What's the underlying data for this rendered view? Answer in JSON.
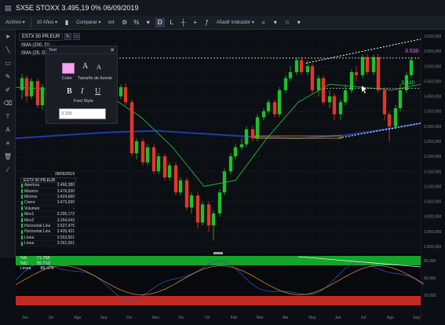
{
  "window": {
    "title": "SX5E STOXX 3.495,19 0% 06/09/2019"
  },
  "toolbar": {
    "archivo": "Archivo ▾",
    "period": "10 Años ▾",
    "compare": "Comparar ▾",
    "vol": "vol.",
    "add_indicator": "Añadir indicador ▾",
    "icons": [
      "menu-icon",
      "bar-style-icon",
      "percent-icon",
      "d-icon",
      "l-icon",
      "crosshair-icon",
      "plus-icon",
      "zoom-icon",
      "settings-icon",
      "star-icon"
    ]
  },
  "legend": {
    "symbol": "ESTX 50 PR.EUR",
    "sma200": "SMA (200, D)",
    "sma25": "SMA (25, D)"
  },
  "text_panel": {
    "title": "Text",
    "color_label": "Color",
    "size_label": "Tamaño de fuente",
    "font_style_label": "Font Style",
    "input_value": "3.330",
    "bold": "B",
    "italic": "I",
    "underline": "U",
    "size_up": "A",
    "size_down": "A",
    "swatch_color": "#f3a1f0"
  },
  "data_panel": {
    "date": "28/06/2019",
    "symbol": "ESTX 50 PR.EUR",
    "rows": [
      {
        "k": "Apertura",
        "v": "3.466,380"
      },
      {
        "k": "Máximo",
        "v": "3.476,930"
      },
      {
        "k": "Mínimo",
        "v": "3.424,680"
      },
      {
        "k": "Cierre",
        "v": "3.473,690"
      },
      {
        "k": "Volumen",
        "v": "-"
      },
      {
        "k": "Mov1",
        "v": "3.295,172"
      },
      {
        "k": "Mov2",
        "v": "3.264,043"
      },
      {
        "k": "Horizontal Line",
        "v": "3.527,475"
      },
      {
        "k": "Horizontal Line",
        "v": "3.426,431"
      },
      {
        "k": "Linea",
        "v": "3.553,501"
      },
      {
        "k": "Linea",
        "v": "3.261,051"
      }
    ]
  },
  "price_axis": [
    "3.600,000",
    "3.550,000",
    "3.500,000",
    "3.450,000",
    "3.400,000",
    "3.350,000",
    "3.300,000",
    "3.250,000",
    "3.200,000",
    "3.150,000",
    "3.100,000",
    "3.050,000",
    "3.000,000",
    "2.950,000",
    "2.900,000"
  ],
  "price_labels": {
    "upper": "3.530",
    "mid": "3.440"
  },
  "time_axis": [
    "Jun",
    "Jul",
    "Ago",
    "Sep",
    "Oct",
    "Nov",
    "Dic",
    "'19",
    "Feb",
    "Mar",
    "Abr",
    "May",
    "Jun",
    "Jul",
    "Ago",
    "Sep"
  ],
  "oscillator": {
    "rows": [
      {
        "k": "%K",
        "v": "71.788"
      },
      {
        "k": "%D",
        "v": "55.710"
      },
      {
        "k": "Linea",
        "v": "89.479"
      }
    ],
    "axis": [
      "80.000",
      "50.000",
      "20.000"
    ]
  },
  "colors": {
    "up": "#1fbf2c",
    "down": "#e5352a",
    "sma200": "#1f3ca8",
    "sma25": "#1faa33",
    "overbought": "#15a52a",
    "oversold": "#c32b22"
  },
  "left_tools": [
    "cursor-icon",
    "line-icon",
    "rectangle-icon",
    "brush-icon",
    "pen-icon",
    "text-icon",
    "text-tool-icon",
    "fibonacci-icon",
    "trash-icon",
    "eyedropper-icon"
  ]
}
